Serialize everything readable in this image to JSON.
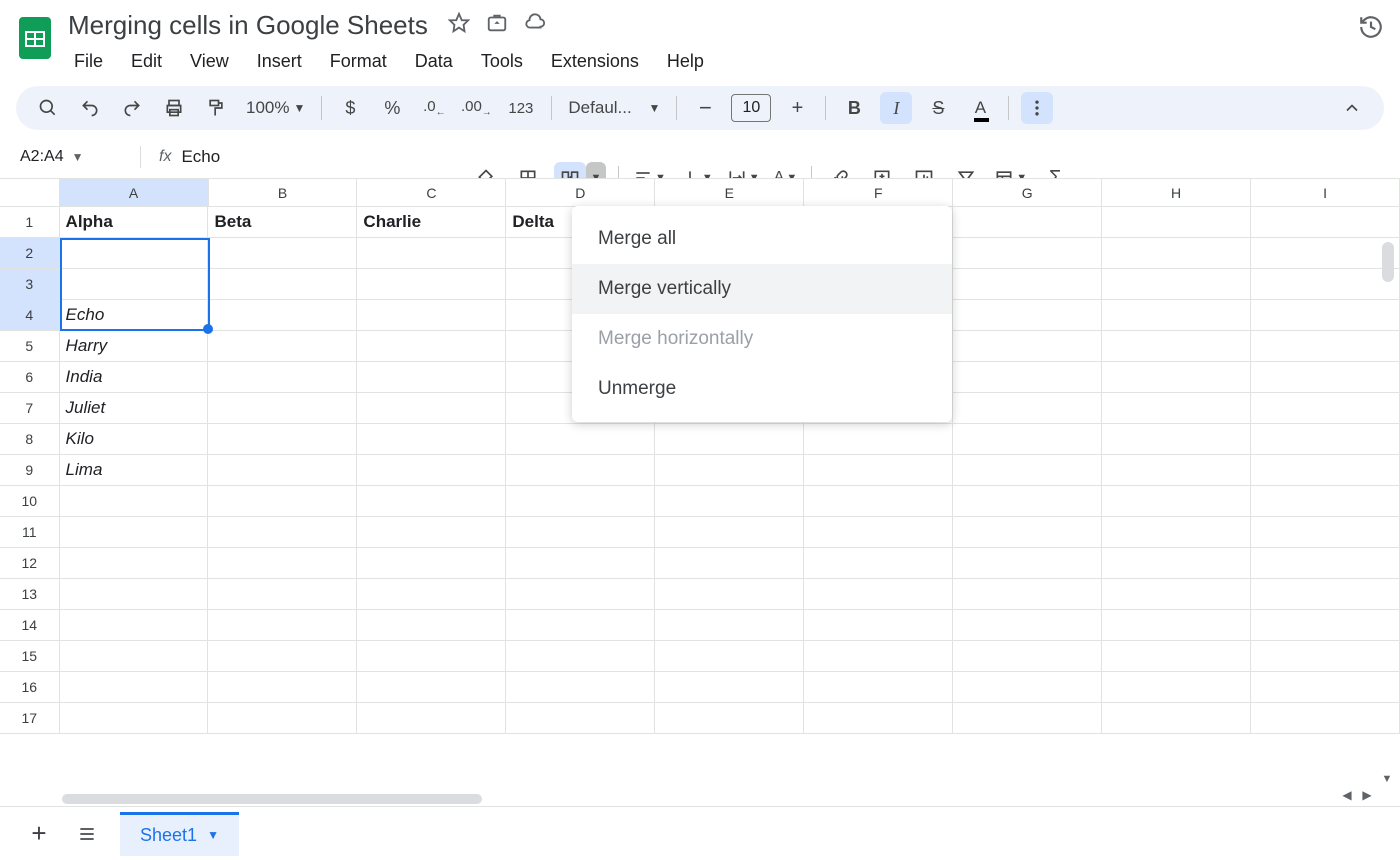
{
  "doc": {
    "title": "Merging cells in Google Sheets"
  },
  "menus": [
    "File",
    "Edit",
    "View",
    "Insert",
    "Format",
    "Data",
    "Tools",
    "Extensions",
    "Help"
  ],
  "toolbar": {
    "zoom": "100%",
    "font": "Defaul...",
    "font_size": "10"
  },
  "namebox": "A2:A4",
  "fx_value": "Echo",
  "columns": [
    "A",
    "B",
    "C",
    "D",
    "E",
    "F",
    "G",
    "H",
    "I"
  ],
  "rows": 17,
  "selected_rows": [
    2,
    3,
    4
  ],
  "selected_col": "A",
  "cells": {
    "r1": {
      "A": "Alpha",
      "B": "Beta",
      "C": "Charlie",
      "D": "Delta"
    },
    "r4": {
      "A": "Echo"
    },
    "r5": {
      "A": "Harry"
    },
    "r6": {
      "A": "India"
    },
    "r7": {
      "A": "Juliet"
    },
    "r8": {
      "A": "Kilo"
    },
    "r9": {
      "A": "Lima"
    }
  },
  "merge_menu": {
    "items": [
      {
        "label": "Merge all",
        "state": "normal"
      },
      {
        "label": "Merge vertically",
        "state": "hovered"
      },
      {
        "label": "Merge horizontally",
        "state": "disabled"
      },
      {
        "label": "Unmerge",
        "state": "normal"
      }
    ]
  },
  "sheet_tab": "Sheet1"
}
